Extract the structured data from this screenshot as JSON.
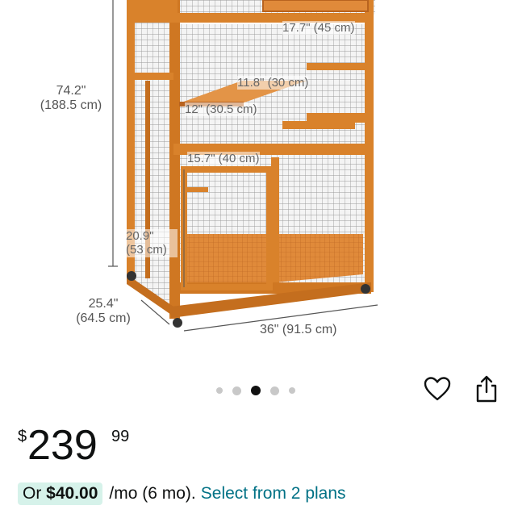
{
  "product_image": {
    "dimensions": {
      "height_in": "74.2\"",
      "height_cm": "(188.5 cm)",
      "depth_in": "25.4\"",
      "depth_cm": "(64.5 cm)",
      "width": "36\" (91.5 cm)",
      "top_width": "17.7\" (45 cm)",
      "shelf_depth": "11.8\" (30 cm)",
      "shelf_width": "12\" (30.5 cm)",
      "door_width": "15.7\" (40 cm)",
      "door_height_in": "20.9\"",
      "door_height_cm": "(53 cm)"
    }
  },
  "carousel": {
    "count": 5,
    "active_index": 2
  },
  "actions": {
    "wishlist_icon": "heart-outline-icon",
    "share_icon": "share-icon"
  },
  "price": {
    "symbol": "$",
    "whole": "239",
    "fraction": "99"
  },
  "financing": {
    "prefix": "Or",
    "amount": "$40.00",
    "terms": "/mo (6 mo).",
    "link": "Select from 2 plans"
  },
  "colors": {
    "link": "#007185",
    "pill": "#d6f2ea",
    "wood": "#d9822b",
    "text": "#0f1111"
  }
}
